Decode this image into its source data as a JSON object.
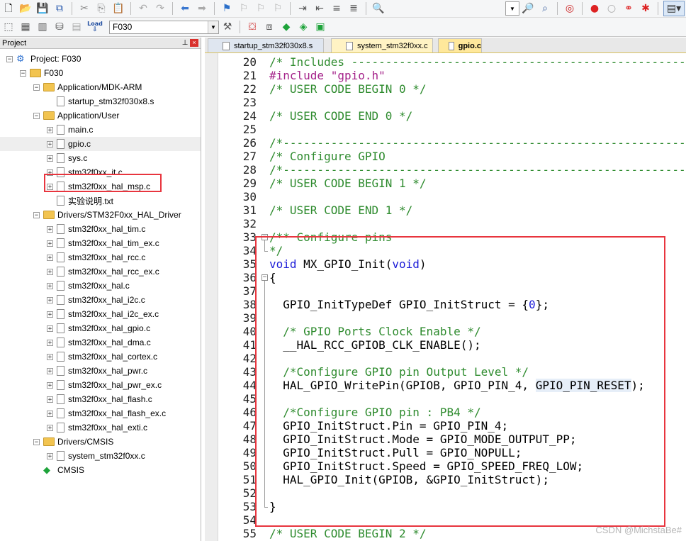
{
  "toolbar_top": {
    "icons": [
      "new-file-icon",
      "open-icon",
      "save-icon",
      "save-all-icon",
      "cut-icon",
      "copy-icon",
      "paste-icon",
      "undo-icon",
      "redo-icon",
      "back-icon",
      "forward-icon",
      "bookmark-icon",
      "bookmark-prev-icon",
      "bookmark-next-icon",
      "bookmark-clear-icon",
      "indent-icon",
      "unindent-icon",
      "comment-icon",
      "uncomment-icon",
      "find-files-icon",
      "find-combo-icon",
      "find-icon",
      "incremental-find-icon",
      "debug-icon",
      "breakpoint-icon",
      "breakpoint-disable-icon",
      "breakpoints-icon",
      "kill-breakpoints-icon",
      "window-layout-icon"
    ]
  },
  "toolbar_build": {
    "load_label": "Load",
    "target_name": "F030"
  },
  "project_panel": {
    "title": "Project",
    "pin_glyph": "⊥",
    "close_glyph": "×",
    "tree": [
      {
        "label": "Project: F030",
        "level": 0,
        "expander": "−",
        "icon": "project"
      },
      {
        "label": "F030",
        "level": 1,
        "expander": "−",
        "icon": "folder"
      },
      {
        "label": "Application/MDK-ARM",
        "level": 2,
        "expander": "−",
        "icon": "folder"
      },
      {
        "label": "startup_stm32f030x8.s",
        "level": 3,
        "expander": "",
        "icon": "file"
      },
      {
        "label": "Application/User",
        "level": 2,
        "expander": "−",
        "icon": "folder"
      },
      {
        "label": "main.c",
        "level": 3,
        "expander": "+",
        "icon": "file"
      },
      {
        "label": "gpio.c",
        "level": 3,
        "expander": "+",
        "icon": "file",
        "selected": true
      },
      {
        "label": "sys.c",
        "level": 3,
        "expander": "+",
        "icon": "file"
      },
      {
        "label": "stm32f0xx_it.c",
        "level": 3,
        "expander": "+",
        "icon": "file"
      },
      {
        "label": "stm32f0xx_hal_msp.c",
        "level": 3,
        "expander": "+",
        "icon": "file"
      },
      {
        "label": "实验说明.txt",
        "level": 3,
        "expander": "",
        "icon": "file"
      },
      {
        "label": "Drivers/STM32F0xx_HAL_Driver",
        "level": 2,
        "expander": "−",
        "icon": "folder"
      },
      {
        "label": "stm32f0xx_hal_tim.c",
        "level": 3,
        "expander": "+",
        "icon": "file"
      },
      {
        "label": "stm32f0xx_hal_tim_ex.c",
        "level": 3,
        "expander": "+",
        "icon": "file"
      },
      {
        "label": "stm32f0xx_hal_rcc.c",
        "level": 3,
        "expander": "+",
        "icon": "file"
      },
      {
        "label": "stm32f0xx_hal_rcc_ex.c",
        "level": 3,
        "expander": "+",
        "icon": "file"
      },
      {
        "label": "stm32f0xx_hal.c",
        "level": 3,
        "expander": "+",
        "icon": "file"
      },
      {
        "label": "stm32f0xx_hal_i2c.c",
        "level": 3,
        "expander": "+",
        "icon": "file"
      },
      {
        "label": "stm32f0xx_hal_i2c_ex.c",
        "level": 3,
        "expander": "+",
        "icon": "file"
      },
      {
        "label": "stm32f0xx_hal_gpio.c",
        "level": 3,
        "expander": "+",
        "icon": "file"
      },
      {
        "label": "stm32f0xx_hal_dma.c",
        "level": 3,
        "expander": "+",
        "icon": "file"
      },
      {
        "label": "stm32f0xx_hal_cortex.c",
        "level": 3,
        "expander": "+",
        "icon": "file"
      },
      {
        "label": "stm32f0xx_hal_pwr.c",
        "level": 3,
        "expander": "+",
        "icon": "file"
      },
      {
        "label": "stm32f0xx_hal_pwr_ex.c",
        "level": 3,
        "expander": "+",
        "icon": "file"
      },
      {
        "label": "stm32f0xx_hal_flash.c",
        "level": 3,
        "expander": "+",
        "icon": "file"
      },
      {
        "label": "stm32f0xx_hal_flash_ex.c",
        "level": 3,
        "expander": "+",
        "icon": "file"
      },
      {
        "label": "stm32f0xx_hal_exti.c",
        "level": 3,
        "expander": "+",
        "icon": "file"
      },
      {
        "label": "Drivers/CMSIS",
        "level": 2,
        "expander": "−",
        "icon": "folder"
      },
      {
        "label": "system_stm32f0xx.c",
        "level": 3,
        "expander": "+",
        "icon": "file"
      },
      {
        "label": "CMSIS",
        "level": 2,
        "expander": "",
        "icon": "gem"
      }
    ]
  },
  "editor_tabs": [
    {
      "label": "startup_stm32f030x8.s",
      "active": false
    },
    {
      "label": "system_stm32f0xx.c",
      "active": false
    },
    {
      "label": "gpio.c",
      "active": true
    }
  ],
  "editor": {
    "lines": [
      {
        "n": "20",
        "tokens": [
          [
            "c-comment",
            "/* Includes ------------------------------------------------------------------*/"
          ]
        ]
      },
      {
        "n": "21",
        "tokens": [
          [
            "c-pre",
            "#include "
          ],
          [
            "c-str",
            "\"gpio.h\""
          ]
        ]
      },
      {
        "n": "22",
        "tokens": [
          [
            "c-comment",
            "/* USER CODE BEGIN 0 */"
          ]
        ]
      },
      {
        "n": "23",
        "tokens": []
      },
      {
        "n": "24",
        "tokens": [
          [
            "c-comment",
            "/* USER CODE END 0 */"
          ]
        ]
      },
      {
        "n": "25",
        "tokens": []
      },
      {
        "n": "26",
        "tokens": [
          [
            "c-comment",
            "/*----------------------------------------------------------------------------*/"
          ]
        ]
      },
      {
        "n": "27",
        "tokens": [
          [
            "c-comment",
            "/* Configure GPIO                                                             */"
          ]
        ]
      },
      {
        "n": "28",
        "tokens": [
          [
            "c-comment",
            "/*----------------------------------------------------------------------------*/"
          ]
        ]
      },
      {
        "n": "29",
        "tokens": [
          [
            "c-comment",
            "/* USER CODE BEGIN 1 */"
          ]
        ]
      },
      {
        "n": "30",
        "tokens": []
      },
      {
        "n": "31",
        "tokens": [
          [
            "c-comment",
            "/* USER CODE END 1 */"
          ]
        ]
      },
      {
        "n": "32",
        "tokens": []
      },
      {
        "n": "33",
        "tokens": [
          [
            "c-comment",
            "/** Configure pins"
          ]
        ],
        "fold": "−"
      },
      {
        "n": "34",
        "tokens": [
          [
            "c-comment",
            "*/"
          ]
        ],
        "foldend": true
      },
      {
        "n": "35",
        "tokens": [
          [
            "c-kw",
            "void"
          ],
          [
            "",
            " MX_GPIO_Init("
          ],
          [
            "c-kw",
            "void"
          ],
          [
            "",
            ")"
          ]
        ]
      },
      {
        "n": "36",
        "tokens": [
          [
            "",
            "{"
          ]
        ],
        "fold": "−"
      },
      {
        "n": "37",
        "tokens": []
      },
      {
        "n": "38",
        "tokens": [
          [
            "",
            "  GPIO_InitTypeDef GPIO_InitStruct = {"
          ],
          [
            "c-num",
            "0"
          ],
          [
            "",
            "};"
          ]
        ]
      },
      {
        "n": "39",
        "tokens": []
      },
      {
        "n": "40",
        "tokens": [
          [
            "",
            "  "
          ],
          [
            "c-comment",
            "/* GPIO Ports Clock Enable */"
          ]
        ]
      },
      {
        "n": "41",
        "tokens": [
          [
            "",
            "  __HAL_RCC_GPIOB_CLK_ENABLE();"
          ]
        ]
      },
      {
        "n": "42",
        "tokens": []
      },
      {
        "n": "43",
        "tokens": [
          [
            "",
            "  "
          ],
          [
            "c-comment",
            "/*Configure GPIO pin Output Level */"
          ]
        ]
      },
      {
        "n": "44",
        "tokens": [
          [
            "",
            "  HAL_GPIO_WritePin(GPIOB, GPIO_PIN_4, "
          ],
          [
            "hl",
            "GPIO_PIN_RESET"
          ],
          [
            "",
            ");"
          ]
        ]
      },
      {
        "n": "45",
        "tokens": []
      },
      {
        "n": "46",
        "tokens": [
          [
            "",
            "  "
          ],
          [
            "c-comment",
            "/*Configure GPIO pin : PB4 */"
          ]
        ]
      },
      {
        "n": "47",
        "tokens": [
          [
            "",
            "  GPIO_InitStruct.Pin = GPIO_PIN_4;"
          ]
        ]
      },
      {
        "n": "48",
        "tokens": [
          [
            "",
            "  GPIO_InitStruct.Mode = GPIO_MODE_OUTPUT_PP;"
          ]
        ]
      },
      {
        "n": "49",
        "tokens": [
          [
            "",
            "  GPIO_InitStruct.Pull = GPIO_NOPULL;"
          ]
        ]
      },
      {
        "n": "50",
        "tokens": [
          [
            "",
            "  GPIO_InitStruct.Speed = GPIO_SPEED_FREQ_LOW;"
          ]
        ]
      },
      {
        "n": "51",
        "tokens": [
          [
            "",
            "  HAL_GPIO_Init(GPIOB, &GPIO_InitStruct);"
          ]
        ]
      },
      {
        "n": "52",
        "tokens": []
      },
      {
        "n": "53",
        "tokens": [
          [
            "",
            "}"
          ]
        ],
        "foldend": true
      },
      {
        "n": "54",
        "tokens": []
      },
      {
        "n": "55",
        "tokens": [
          [
            "c-comment",
            "/* USER CODE BEGIN 2 */"
          ]
        ]
      }
    ]
  },
  "colors": {
    "highlight_box": "#e8353e",
    "comment": "#2e8b2e",
    "keyword": "#1d1dd8",
    "preprocessor": "#a4228a"
  },
  "watermark": "CSDN @MichstaBe#"
}
